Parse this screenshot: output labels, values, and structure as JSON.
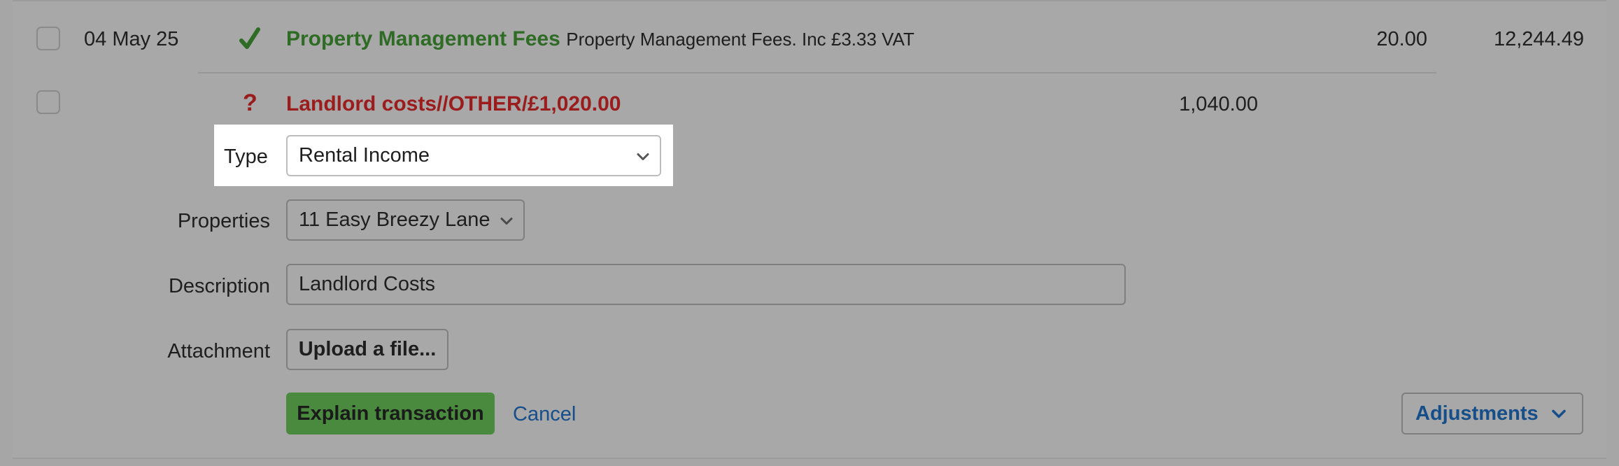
{
  "transactions": [
    {
      "date": "04 May 25",
      "status_icon": "check-icon",
      "title": "Property Management Fees",
      "subtitle": "Property Management Fees. Inc £3.33 VAT",
      "amount": "20.00",
      "balance": "12,244.49",
      "title_color": "#2e6b24"
    },
    {
      "status_icon": "question-icon",
      "status_glyph": "?",
      "title": "Landlord costs//OTHER/£1,020.00",
      "amount": "1,040.00",
      "title_color": "#9b1c1c"
    }
  ],
  "form": {
    "type_label": "Type",
    "type_value": "Rental Income",
    "properties_label": "Properties",
    "properties_value": "11 Easy Breezy Lane",
    "description_label": "Description",
    "description_value": "Landlord Costs",
    "attachment_label": "Attachment",
    "upload_label": "Upload a file...",
    "explain_label": "Explain transaction",
    "cancel_label": "Cancel",
    "adjustments_label": "Adjustments"
  },
  "colors": {
    "overlay_gray": "#a8a8a8",
    "highlight_white": "#ffffff",
    "link_blue": "#164e8a",
    "button_green": "#4a8a3e"
  }
}
